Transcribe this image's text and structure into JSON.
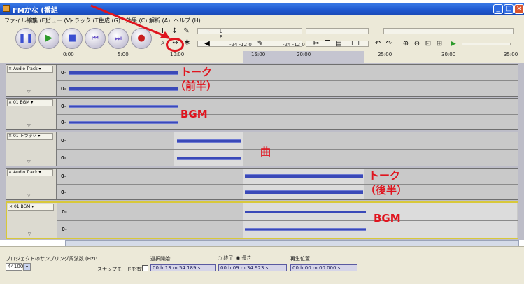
{
  "window": {
    "title": "FMかな (番組",
    "min": "_",
    "max": "□",
    "close": "×"
  },
  "menu": [
    "ファイル (F)",
    "編集 (E)",
    "ビュー (V)",
    "トラック (T)",
    "生成 (G)",
    "効果 (C)",
    "解析 (A)",
    "ヘルプ (H)"
  ],
  "transport": {
    "pause": "❚❚",
    "play": "▶",
    "stop": "■",
    "skip_start": "⏮",
    "skip_end": "⏭",
    "record": "●"
  },
  "meters": {
    "l": "L",
    "r": "R",
    "db1": "-24 -12 0",
    "db2": "-24 -12 0"
  },
  "ruler": [
    "0:00",
    "5:00",
    "10:00",
    "15:00",
    "20:00",
    "25:00",
    "30:00",
    "35:00"
  ],
  "tracks": [
    {
      "name": "Audio Track",
      "chan_label": "0-"
    },
    {
      "name": "01 BGM",
      "chan_label": "0-"
    },
    {
      "name": "01 トラック",
      "chan_label": "0-"
    },
    {
      "name": "Audio Track",
      "chan_label": "0-"
    },
    {
      "name": "01 BGM",
      "chan_label": "0-"
    }
  ],
  "annotations": {
    "talk1": "トーク",
    "talk1b": "（前半）",
    "bgm1": "BGM",
    "song": "曲",
    "talk2": "トーク",
    "talk2b": "（後半）",
    "bgm2": "BGM"
  },
  "selection": {
    "rate_label": "プロジェクトのサンプリング周波数 (Hz):",
    "rate_value": "44100",
    "snap_label": "スナップモードを有効",
    "start_label": "選択開始:",
    "end_label": "終了",
    "length_label": "長さ",
    "start_value": "00 h 13 m 54.189 s",
    "length_value": "00 h 09 m 34.923 s",
    "pos_label": "再生位置",
    "pos_value": "00 h 00 m 00.000 s"
  },
  "colors": {
    "annotation": "#e0141e",
    "waveform": "#3a49b8",
    "titlebar": "#1e57cf"
  }
}
